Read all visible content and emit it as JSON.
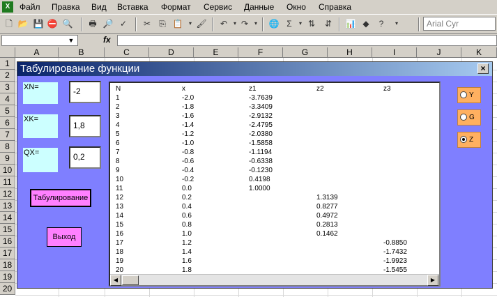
{
  "menu": {
    "items": [
      "Файл",
      "Правка",
      "Вид",
      "Вставка",
      "Формат",
      "Сервис",
      "Данные",
      "Окно",
      "Справка"
    ]
  },
  "toolbar": {
    "font_name": "Arial Cyr",
    "undo_icon": "undo-icon",
    "redo_icon": "redo-icon"
  },
  "formula": {
    "fx_label": "fx"
  },
  "grid": {
    "columns": [
      "A",
      "B",
      "C",
      "D",
      "E",
      "F",
      "G",
      "H",
      "I",
      "J",
      "K"
    ],
    "rows": [
      "1",
      "2",
      "3",
      "4",
      "5",
      "6",
      "7",
      "8",
      "9",
      "10",
      "11",
      "12",
      "13",
      "14",
      "15",
      "16",
      "17",
      "18",
      "19",
      "20"
    ]
  },
  "dialog": {
    "title": "Табулирование функции",
    "close_label": "×",
    "xn_label": "XN=",
    "xn_value": "-2",
    "xk_label": "XK=",
    "xk_value": "1,8",
    "qx_label": "QX=",
    "qx_value": "0,2",
    "tab_button": "Табулирование",
    "exit_button": "Выход",
    "options": [
      {
        "label": "Y",
        "selected": false
      },
      {
        "label": "G",
        "selected": false
      },
      {
        "label": "Z",
        "selected": true
      }
    ],
    "list": {
      "headers": [
        "N",
        "x",
        "z1",
        "z2",
        "z3"
      ],
      "rows": [
        [
          "1",
          "-2.0",
          "-3.7639",
          "",
          ""
        ],
        [
          "2",
          "-1.8",
          "-3.3409",
          "",
          ""
        ],
        [
          "3",
          "-1.6",
          "-2.9132",
          "",
          ""
        ],
        [
          "4",
          "-1.4",
          "-2.4795",
          "",
          ""
        ],
        [
          "5",
          "-1.2",
          "-2.0380",
          "",
          ""
        ],
        [
          "6",
          "-1.0",
          "-1.5858",
          "",
          ""
        ],
        [
          "7",
          "-0.8",
          "-1.1194",
          "",
          ""
        ],
        [
          "8",
          "-0.6",
          "-0.6338",
          "",
          ""
        ],
        [
          "9",
          "-0.4",
          "-0.1230",
          "",
          ""
        ],
        [
          "10",
          "-0.2",
          "0.4198",
          "",
          ""
        ],
        [
          "11",
          "0.0",
          "1.0000",
          "",
          ""
        ],
        [
          "12",
          "0.2",
          "",
          "1.3139",
          ""
        ],
        [
          "13",
          "0.4",
          "",
          "0.8277",
          ""
        ],
        [
          "14",
          "0.6",
          "",
          "0.4972",
          ""
        ],
        [
          "15",
          "0.8",
          "",
          "0.2813",
          ""
        ],
        [
          "16",
          "1.0",
          "",
          "0.1462",
          ""
        ],
        [
          "17",
          "1.2",
          "",
          "",
          "-0.8850"
        ],
        [
          "18",
          "1.4",
          "",
          "",
          "-1.7432"
        ],
        [
          "19",
          "1.6",
          "",
          "",
          "-1.9923"
        ],
        [
          "20",
          "1.8",
          "",
          "",
          "-1.5455"
        ]
      ]
    }
  }
}
